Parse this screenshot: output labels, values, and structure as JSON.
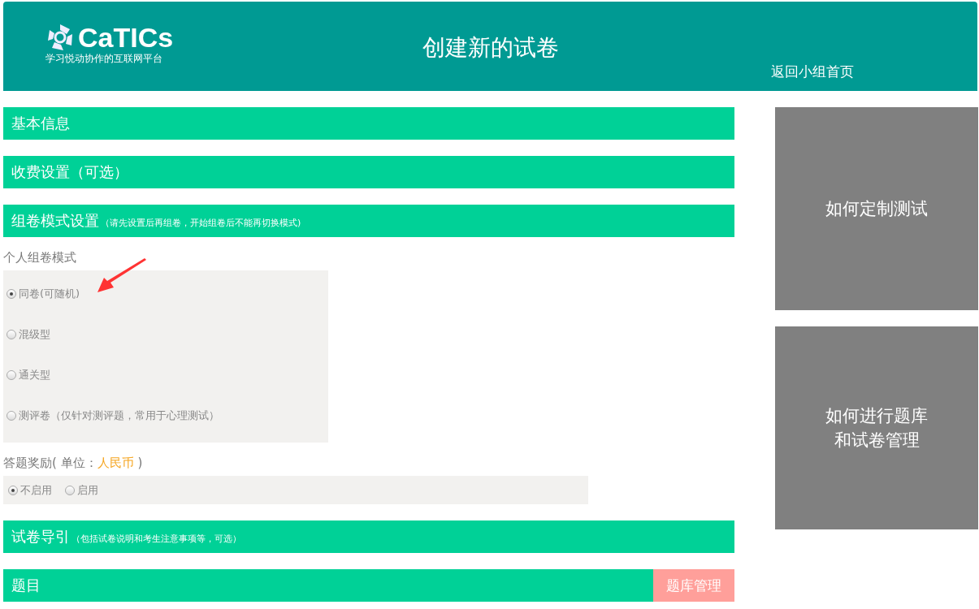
{
  "header": {
    "logo_text": "CaTICs",
    "slogan": "学习悦动协作的互联网平台",
    "title": "创建新的试卷",
    "back_link": "返回小组首页"
  },
  "sections_top": [
    {
      "title": "基本信息"
    },
    {
      "title": "收费设置（可选）"
    },
    {
      "title": "组卷模式设置",
      "note": "（请先设置后再组卷，开始组卷后不能再切换模式)"
    }
  ],
  "mode": {
    "label": "个人组卷模式",
    "options": [
      {
        "label": "同卷(可随机)",
        "selected": true
      },
      {
        "label": "混级型",
        "selected": false
      },
      {
        "label": "通关型",
        "selected": false
      },
      {
        "label": "测评卷（仅针对测评题，常用于心理测试）",
        "selected": false
      }
    ]
  },
  "reward": {
    "label_prefix": "答题奖励( 单位：",
    "unit": "人民币",
    "label_suffix": " )",
    "options": [
      {
        "label": "不启用",
        "selected": true
      },
      {
        "label": "启用",
        "selected": false
      }
    ]
  },
  "sections_bottom": [
    {
      "title": "试卷导引",
      "note": "（包括试卷说明和考生注意事项等，可选）"
    },
    {
      "title": "题目",
      "button": "题库管理"
    }
  ],
  "side_cards": [
    {
      "text": "如何定制测试"
    },
    {
      "text": "如何进行题库和试卷管理"
    }
  ]
}
